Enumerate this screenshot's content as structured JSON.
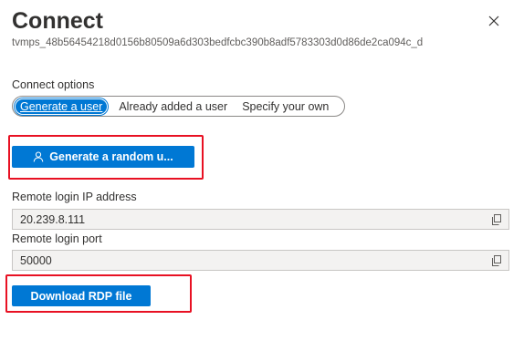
{
  "panel": {
    "title": "Connect",
    "resource_id": "tvmps_48b56454218d0156b80509a6d303bedfcbc390b8adf5783303d0d86de2ca094c_d",
    "close_icon": "close-icon"
  },
  "connect_options": {
    "label": "Connect options",
    "options": [
      {
        "label": "Generate a user",
        "selected": true
      },
      {
        "label": "Already added a user",
        "selected": false
      },
      {
        "label": "Specify your own",
        "selected": false
      }
    ]
  },
  "generate_button": {
    "label": "Generate a random u...",
    "icon": "person-icon"
  },
  "remote_ip": {
    "label": "Remote login IP address",
    "value": "20.239.8.111",
    "copy_icon": "copy-icon"
  },
  "remote_port": {
    "label": "Remote login port",
    "value": "50000",
    "copy_icon": "copy-icon"
  },
  "download_button": {
    "label": "Download RDP file"
  },
  "colors": {
    "accent": "#0078d4",
    "highlight": "#e81123",
    "field_bg": "#f3f2f1"
  }
}
